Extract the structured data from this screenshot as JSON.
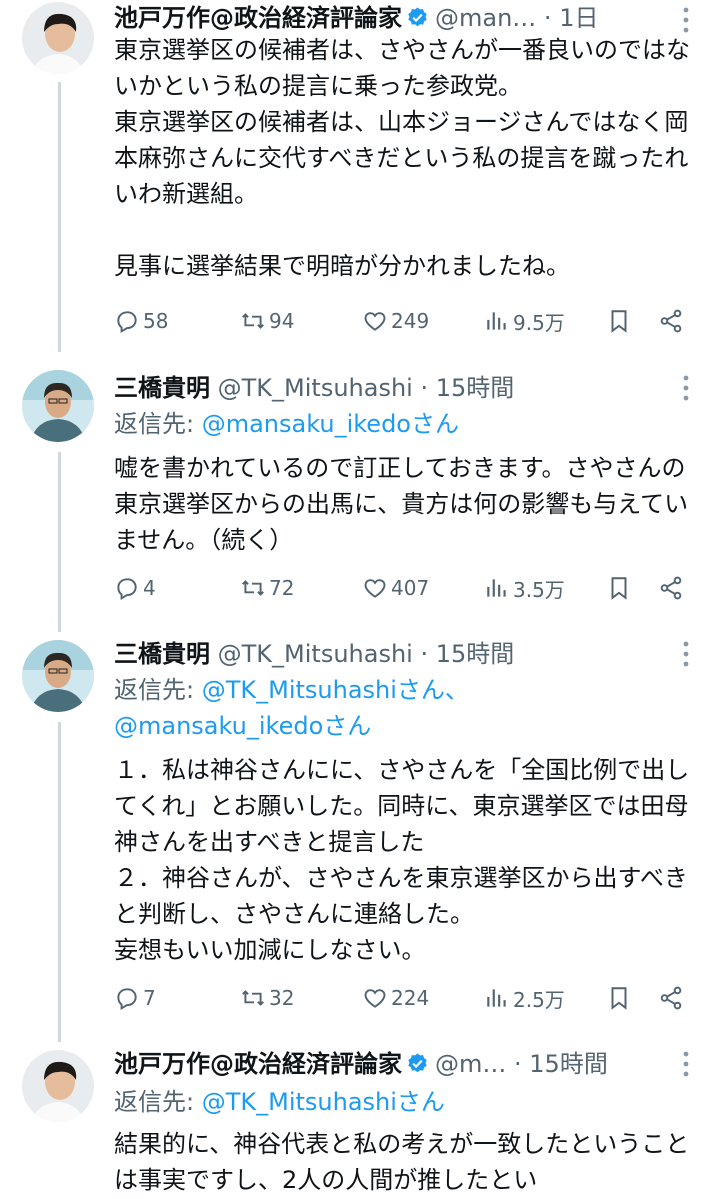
{
  "tweets": [
    {
      "name": "池戸万作@政治経済評論家",
      "handle": "@man…",
      "sep": " · ",
      "time": "1日",
      "body": "東京選挙区の候補者は、さやさんが一番良いのではないかという私の提言に乗った参政党。\n東京選挙区の候補者は、山本ジョージさんではなく岡本麻弥さんに交代すべきだという私の提言を蹴ったれいわ新選組。\n\n見事に選挙結果で明暗が分かれましたね。",
      "replies": "58",
      "reposts": "94",
      "likes": "249",
      "views": "9.5万"
    },
    {
      "name": "三橋貴明",
      "handle": "@TK_Mitsuhashi",
      "sep": " · ",
      "time": "15時間",
      "reply_prefix": "返信先: ",
      "reply_handles": "@mansaku_ikedoさん",
      "body": "嘘を書かれているので訂正しておきます。さやさんの東京選挙区からの出馬に、貴方は何の影響も与えていません。（続く）",
      "replies": "4",
      "reposts": "72",
      "likes": "407",
      "views": "3.5万"
    },
    {
      "name": "三橋貴明",
      "handle": "@TK_Mitsuhashi",
      "sep": " · ",
      "time": "15時間",
      "reply_prefix": "返信先: ",
      "reply_handles": "@TK_Mitsuhashiさん、",
      "reply_handles_2": "@mansaku_ikedoさん",
      "body": "１．私は神谷さんにに、さやさんを「全国比例で出してくれ」とお願いした。同時に、東京選挙区では田母神さんを出すべきと提言した\n２．神谷さんが、さやさんを東京選挙区から出すべきと判断し、さやさんに連絡した。\n妄想もいい加減にしなさい。",
      "replies": "7",
      "reposts": "32",
      "likes": "224",
      "views": "2.5万"
    },
    {
      "name": "池戸万作@政治経済評論家",
      "handle": "@m…",
      "sep": " · ",
      "time": "15時間",
      "reply_prefix": "返信先: ",
      "reply_handles": "@TK_Mitsuhashiさん",
      "body": "結果的に、神谷代表と私の考えが一致したということは事実ですし、2人の人間が推したとい"
    }
  ],
  "colors": {
    "accent": "#1d9bf0",
    "secondary": "#536471",
    "thread": "#cfd9de"
  }
}
